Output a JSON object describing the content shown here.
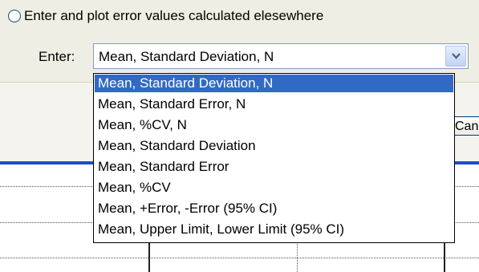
{
  "error_source": {
    "radio_label": "Enter and plot error values calculated elesewhere",
    "enter_label": "Enter:",
    "selected_value": "Mean, Standard Deviation, N"
  },
  "dropdown": {
    "options": [
      "Mean, Standard Deviation, N",
      "Mean, Standard Error, N",
      "Mean, %CV, N",
      "Mean, Standard Deviation",
      "Mean, Standard Error",
      "Mean, %CV",
      "Mean, +Error, -Error (95% CI)",
      "Mean, Upper Limit, Lower Limit (95% CI)"
    ],
    "highlighted_index": 0
  },
  "buttons": {
    "cancel_label": "Cancel"
  },
  "colors": {
    "selection": "#316ac5",
    "accent_rule": "#1f4fc8",
    "dialog_bg": "#efeee4"
  },
  "icons": {
    "combo_arrow": "chevron-down-icon"
  }
}
